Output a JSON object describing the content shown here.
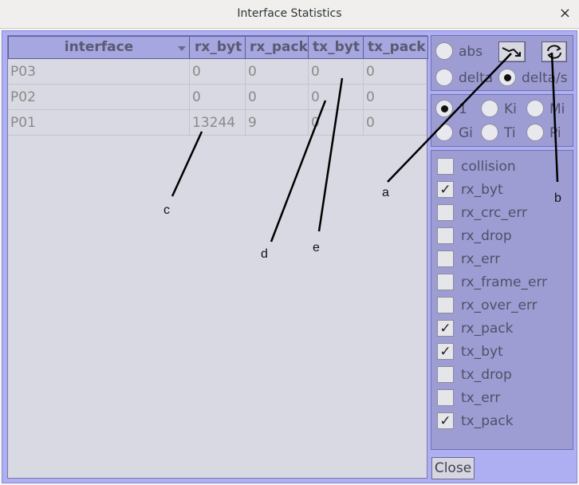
{
  "window": {
    "title": "Interface Statistics",
    "close_glyph": "×"
  },
  "table": {
    "columns": [
      "interface",
      "rx_byt",
      "rx_pack",
      "tx_byt",
      "tx_pack"
    ],
    "rows": [
      [
        "P03",
        "0",
        "0",
        "0",
        "0"
      ],
      [
        "P02",
        "0",
        "0",
        "0",
        "0"
      ],
      [
        "P01",
        "13244",
        "9",
        "0",
        "0"
      ]
    ]
  },
  "mode_options": [
    {
      "label": "abs",
      "selected": false
    },
    {
      "label": "delta",
      "selected": false
    },
    {
      "label": "delta/s",
      "selected": true
    }
  ],
  "toolbar": {
    "trend_icon": "trend-down-icon",
    "refresh_icon": "refresh-icon"
  },
  "unit_options": [
    {
      "label": "1",
      "selected": true
    },
    {
      "label": "Ki",
      "selected": false
    },
    {
      "label": "Mi",
      "selected": false
    },
    {
      "label": "Gi",
      "selected": false
    },
    {
      "label": "Ti",
      "selected": false
    },
    {
      "label": "Pi",
      "selected": false
    }
  ],
  "checkboxes": [
    {
      "label": "collision",
      "checked": false
    },
    {
      "label": "rx_byt",
      "checked": true
    },
    {
      "label": "rx_crc_err",
      "checked": false
    },
    {
      "label": "rx_drop",
      "checked": false
    },
    {
      "label": "rx_err",
      "checked": false
    },
    {
      "label": "rx_frame_err",
      "checked": false
    },
    {
      "label": "rx_over_err",
      "checked": false
    },
    {
      "label": "rx_pack",
      "checked": true
    },
    {
      "label": "tx_byt",
      "checked": true
    },
    {
      "label": "tx_drop",
      "checked": false
    },
    {
      "label": "tx_err",
      "checked": false
    },
    {
      "label": "tx_pack",
      "checked": true
    }
  ],
  "close_button": {
    "label": "Close"
  },
  "annotations": {
    "a": "a",
    "b": "b",
    "c": "c",
    "d": "d",
    "e": "e"
  }
}
